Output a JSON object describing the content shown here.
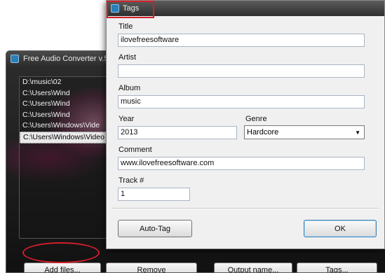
{
  "converter": {
    "title": "Free Audio Converter v.5",
    "files": [
      "D:\\music\\02",
      "C:\\Users\\Wind",
      "C:\\Users\\Wind",
      "C:\\Users\\Wind",
      "C:\\Users\\Windows\\Vide",
      "C:\\Users\\Windows\\Video"
    ],
    "buttons": {
      "add_files": "Add files...",
      "remove": "Remove",
      "output_name": "Output name...",
      "tags": "Tags..."
    }
  },
  "tags_dialog": {
    "title": "Tags",
    "fields": {
      "title_label": "Title",
      "title_value": "ilovefreesoftware",
      "artist_label": "Artist",
      "artist_value": "",
      "album_label": "Album",
      "album_value": "music",
      "year_label": "Year",
      "year_value": "2013",
      "genre_label": "Genre",
      "genre_value": "Hardcore",
      "comment_label": "Comment",
      "comment_value": "www.ilovefreesoftware.com",
      "track_label": "Track #",
      "track_value": "1"
    },
    "buttons": {
      "auto_tag": "Auto-Tag",
      "ok": "OK"
    }
  },
  "highlight_color": "#d11f2a",
  "icons": {
    "app_icon": "audio-converter-icon",
    "dropdown": "chevron-down-icon"
  }
}
